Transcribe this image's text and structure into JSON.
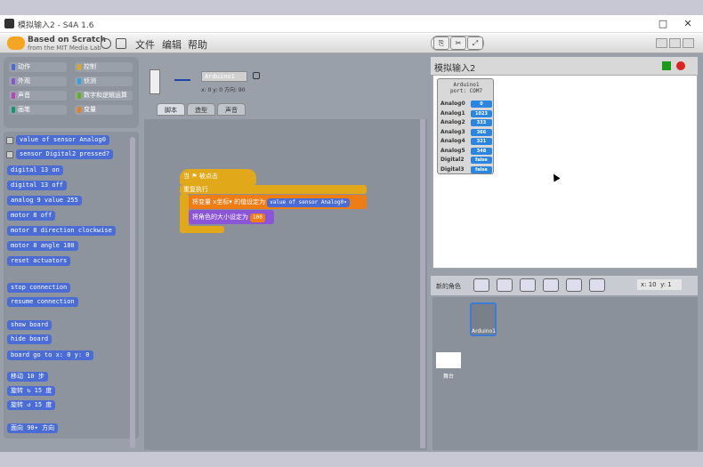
{
  "window": {
    "title": "模拟输入2 - S4A 1.6"
  },
  "logo": {
    "line1": "Based on Scratch",
    "line2": "from the MIT Media Lab"
  },
  "menu": [
    {
      "label": "文件"
    },
    {
      "label": "编辑"
    },
    {
      "label": "帮助"
    }
  ],
  "categories": [
    {
      "label": "动作",
      "color": "#4a6cd4"
    },
    {
      "label": "控制",
      "color": "#e1a91a"
    },
    {
      "label": "外观",
      "color": "#8a55d7"
    },
    {
      "label": "侦测",
      "color": "#2ca5e2"
    },
    {
      "label": "声音",
      "color": "#bb42c3"
    },
    {
      "label": "数字和逻辑运算",
      "color": "#5cb712"
    },
    {
      "label": "画笔",
      "color": "#0e9a6c"
    },
    {
      "label": "变量",
      "color": "#ee7d16"
    }
  ],
  "palette": [
    {
      "text": "value of sensor Analog0",
      "check": true
    },
    {
      "text": "sensor Digital2 pressed?",
      "check": true
    },
    {
      "text": "digital 13 on"
    },
    {
      "text": "digital 13 off"
    },
    {
      "text": "analog 9 value 255"
    },
    {
      "text": "motor 8 off"
    },
    {
      "text": "motor 8 direction clockwise"
    },
    {
      "text": "motor 8 angle 180"
    },
    {
      "text": "reset actuators"
    },
    {
      "text": "stop connection"
    },
    {
      "text": "resume connection"
    },
    {
      "text": "show board"
    },
    {
      "text": "hide board"
    },
    {
      "text": "board go to x: 0 y: 0"
    },
    {
      "text": "移动 10 步"
    },
    {
      "text": "旋转 ↻ 15 度"
    },
    {
      "text": "旋转 ↺ 15 度"
    },
    {
      "text": "面向 90▾ 方向"
    }
  ],
  "sprite": {
    "name": "Arduino1",
    "coords": "x: 0   y: 0   方向: 90"
  },
  "tabs": [
    {
      "label": "脚本"
    },
    {
      "label": "造型"
    },
    {
      "label": "声音"
    }
  ],
  "script": {
    "hat": "当 ⚑ 被点击",
    "loop": "重复执行",
    "set1": "将变量 x坐标▾ 的值设定为",
    "set1_reporter": "value of sensor Analog0▾",
    "set2": "将角色的大小设定为",
    "set2_value": "100"
  },
  "stage": {
    "title": "模拟输入2"
  },
  "watcher": {
    "title": "Arduino1\nport: COM7",
    "rows": [
      {
        "label": "Analog0",
        "value": "0"
      },
      {
        "label": "Analog1",
        "value": "1023"
      },
      {
        "label": "Analog2",
        "value": "333"
      },
      {
        "label": "Analog3",
        "value": "366"
      },
      {
        "label": "Analog4",
        "value": "321"
      },
      {
        "label": "Analog5",
        "value": "348"
      },
      {
        "label": "Digital2",
        "value": "false"
      },
      {
        "label": "Digital3",
        "value": "false"
      }
    ]
  },
  "newsprite": {
    "label": "新的角色"
  },
  "mouse": {
    "x": "x: 10",
    "y": "y: 1"
  },
  "sprites": [
    {
      "label": "Arduino1"
    }
  ],
  "stagecard": {
    "label": "舞台"
  }
}
